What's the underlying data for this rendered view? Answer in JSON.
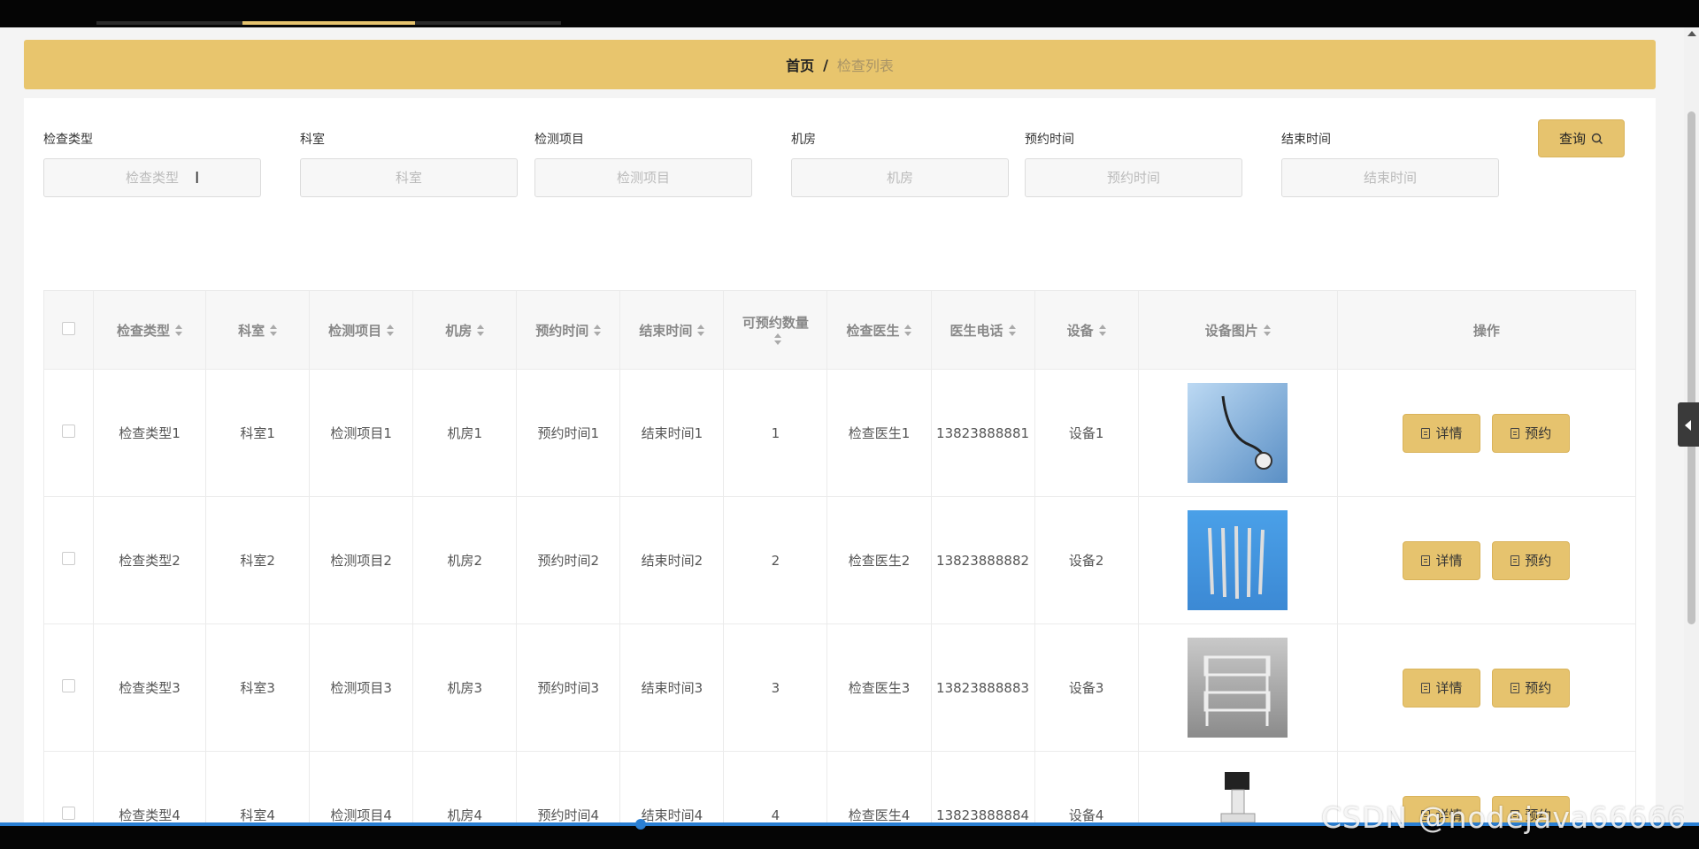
{
  "breadcrumb": {
    "home": "首页",
    "separator": "/",
    "current": "检查列表"
  },
  "filters": [
    {
      "label": "检查类型",
      "placeholder": "检查类型"
    },
    {
      "label": "科室",
      "placeholder": "科室"
    },
    {
      "label": "检测项目",
      "placeholder": "检测项目"
    },
    {
      "label": "机房",
      "placeholder": "机房"
    },
    {
      "label": "预约时间",
      "placeholder": "预约时间"
    },
    {
      "label": "结束时间",
      "placeholder": "结束时间"
    }
  ],
  "search_button": {
    "label": "查询",
    "icon": "search-icon"
  },
  "table": {
    "headers": [
      "检查类型",
      "科室",
      "检测项目",
      "机房",
      "预约时间",
      "结束时间",
      "可预约数量",
      "检查医生",
      "医生电话",
      "设备",
      "设备图片",
      "操作"
    ],
    "rows": [
      {
        "type": "检查类型1",
        "dept": "科室1",
        "item": "检测项目1",
        "room": "机房1",
        "start": "预约时间1",
        "end": "结束时间1",
        "count": "1",
        "doctor": "检查医生1",
        "phone": "13823888881",
        "device": "设备1",
        "image": "stethoscope"
      },
      {
        "type": "检查类型2",
        "dept": "科室2",
        "item": "检测项目2",
        "room": "机房2",
        "start": "预约时间2",
        "end": "结束时间2",
        "count": "2",
        "doctor": "检查医生2",
        "phone": "13823888882",
        "device": "设备2",
        "image": "surgical-scalpels"
      },
      {
        "type": "检查类型3",
        "dept": "科室3",
        "item": "检测项目3",
        "room": "机房3",
        "start": "预约时间3",
        "end": "结束时间3",
        "count": "3",
        "doctor": "检查医生3",
        "phone": "13823888883",
        "device": "设备3",
        "image": "glass-cart"
      },
      {
        "type": "检查类型4",
        "dept": "科室4",
        "item": "检测项目4",
        "room": "机房4",
        "start": "预约时间4",
        "end": "结束时间4",
        "count": "4",
        "doctor": "检查医生4",
        "phone": "13823888884",
        "device": "设备4",
        "image": "ultrasound-machine"
      }
    ],
    "actions": {
      "detail": "详情",
      "book": "预约"
    }
  },
  "watermark": "CSDN @nodejava666666",
  "colors": {
    "accent": "#e6c36e",
    "header_bg": "#e8c56d",
    "progress": "#2a7fd3"
  }
}
